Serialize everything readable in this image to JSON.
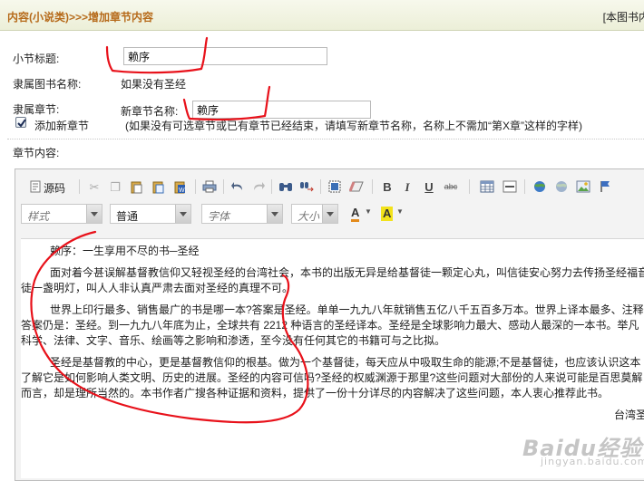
{
  "header": {
    "breadcrumb": "内容(小说类)>>>增加章节内容",
    "right_link": "[本图书内"
  },
  "form": {
    "section_title_label": "小节标题:",
    "section_title_value": "赖序",
    "book_name_label": "隶属图书名称:",
    "book_name_value": "如果没有圣经",
    "chapter_label": "隶属章节:",
    "new_chapter_label": "新章节名称:",
    "new_chapter_value": "赖序",
    "add_chapter_checked": true,
    "add_chapter_label": "添加新章节",
    "add_chapter_hint": "(如果没有可选章节或已有章节已经结束，请填写新章节名称，名称上不需加“第X章”这样的字样)",
    "content_label": "章节内容:"
  },
  "editor": {
    "source_label": "源码",
    "style_placeholder": "样式",
    "format_value": "普通",
    "font_placeholder": "字体",
    "size_placeholder": "大小",
    "font_color_glyph": "A",
    "bg_color_glyph": "A",
    "bold": "B",
    "italic": "I",
    "underline": "U",
    "strike": "abc",
    "paragraphs": [
      "赖序：一生享用不尽的书─圣经",
      "面对着今甚误解基督教信仰又轻视圣经的台湾社会，本书的出版无异是给基督徒一颗定心丸，叫信徒安心努力去传扬圣经福音",
      "徒一盏明灯，叫人人非认真严肃去面对圣经的真理不可。",
      "世界上印行最多、销售最广的书是哪一本?答案是圣经。单单一九九八年就销售五亿八千五百多万本。世界上译本最多、注释",
      "答案仍是：圣经。到一九九八年底为止，全球共有 2212 种语言的圣经译本。圣经是全球影响力最大、感动人最深的一本书。举凡",
      "科学、法律、文字、音乐、绘画等之影响和渗透，至今没有任何其它的书籍可与之比拟。",
      "圣经是基督教的中心，更是基督教信仰的根基。做为一个基督徒，每天应从中吸取生命的能源;不是基督徒，也应该认识这本",
      "了解它是如何影响人类文明、历史的进展。圣经的内容可信吗?圣经的权威渊源于那里?这些问题对大部份的人来说可能是百思莫解",
      "而言，却是理所当然的。本书作者广搜各种证据和资料，提供了一份十分详尽的内容解决了这些问题，本人衷心推荐此书。",
      "台湾圣"
    ]
  },
  "watermark": {
    "brand": "Baidu经验",
    "url": "jingyan.baidu.com"
  },
  "colors": {
    "breadcrumb": "#b66a1a",
    "annotation": "#e8111a",
    "header_bg": "#ecefd8"
  },
  "icons": [
    "cut-icon",
    "copy-icon",
    "paste-icon",
    "paste-text-icon",
    "paste-word-icon",
    "print-icon",
    "undo-icon",
    "redo-icon",
    "find-icon",
    "replace-icon",
    "select-all-icon",
    "remove-format-icon",
    "table-icon",
    "horizontal-rule-icon",
    "link-icon",
    "unlink-icon",
    "image-icon",
    "flag-icon"
  ]
}
